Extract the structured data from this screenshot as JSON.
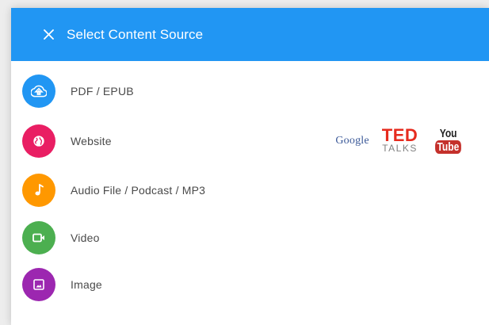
{
  "dialog": {
    "title": "Select Content Source",
    "close_icon": "close-icon"
  },
  "sources": [
    {
      "label": "PDF / EPUB",
      "icon": "cloud-upload-icon",
      "color": "#2196f3"
    },
    {
      "label": "Website",
      "icon": "globe-icon",
      "color": "#e91e63"
    },
    {
      "label": "Audio File / Podcast / MP3",
      "icon": "music-note-icon",
      "color": "#ff9800"
    },
    {
      "label": "Video",
      "icon": "video-camera-icon",
      "color": "#4caf50"
    },
    {
      "label": "Image",
      "icon": "image-icon",
      "color": "#9c27b0"
    }
  ],
  "website_logos": {
    "google": "Google",
    "ted": "TED",
    "ted_sub": "TALKS",
    "youtube_top": "You",
    "youtube_bottom": "Tube"
  },
  "colors": {
    "header": "#2196f3",
    "label_text": "#4a4a4a"
  }
}
